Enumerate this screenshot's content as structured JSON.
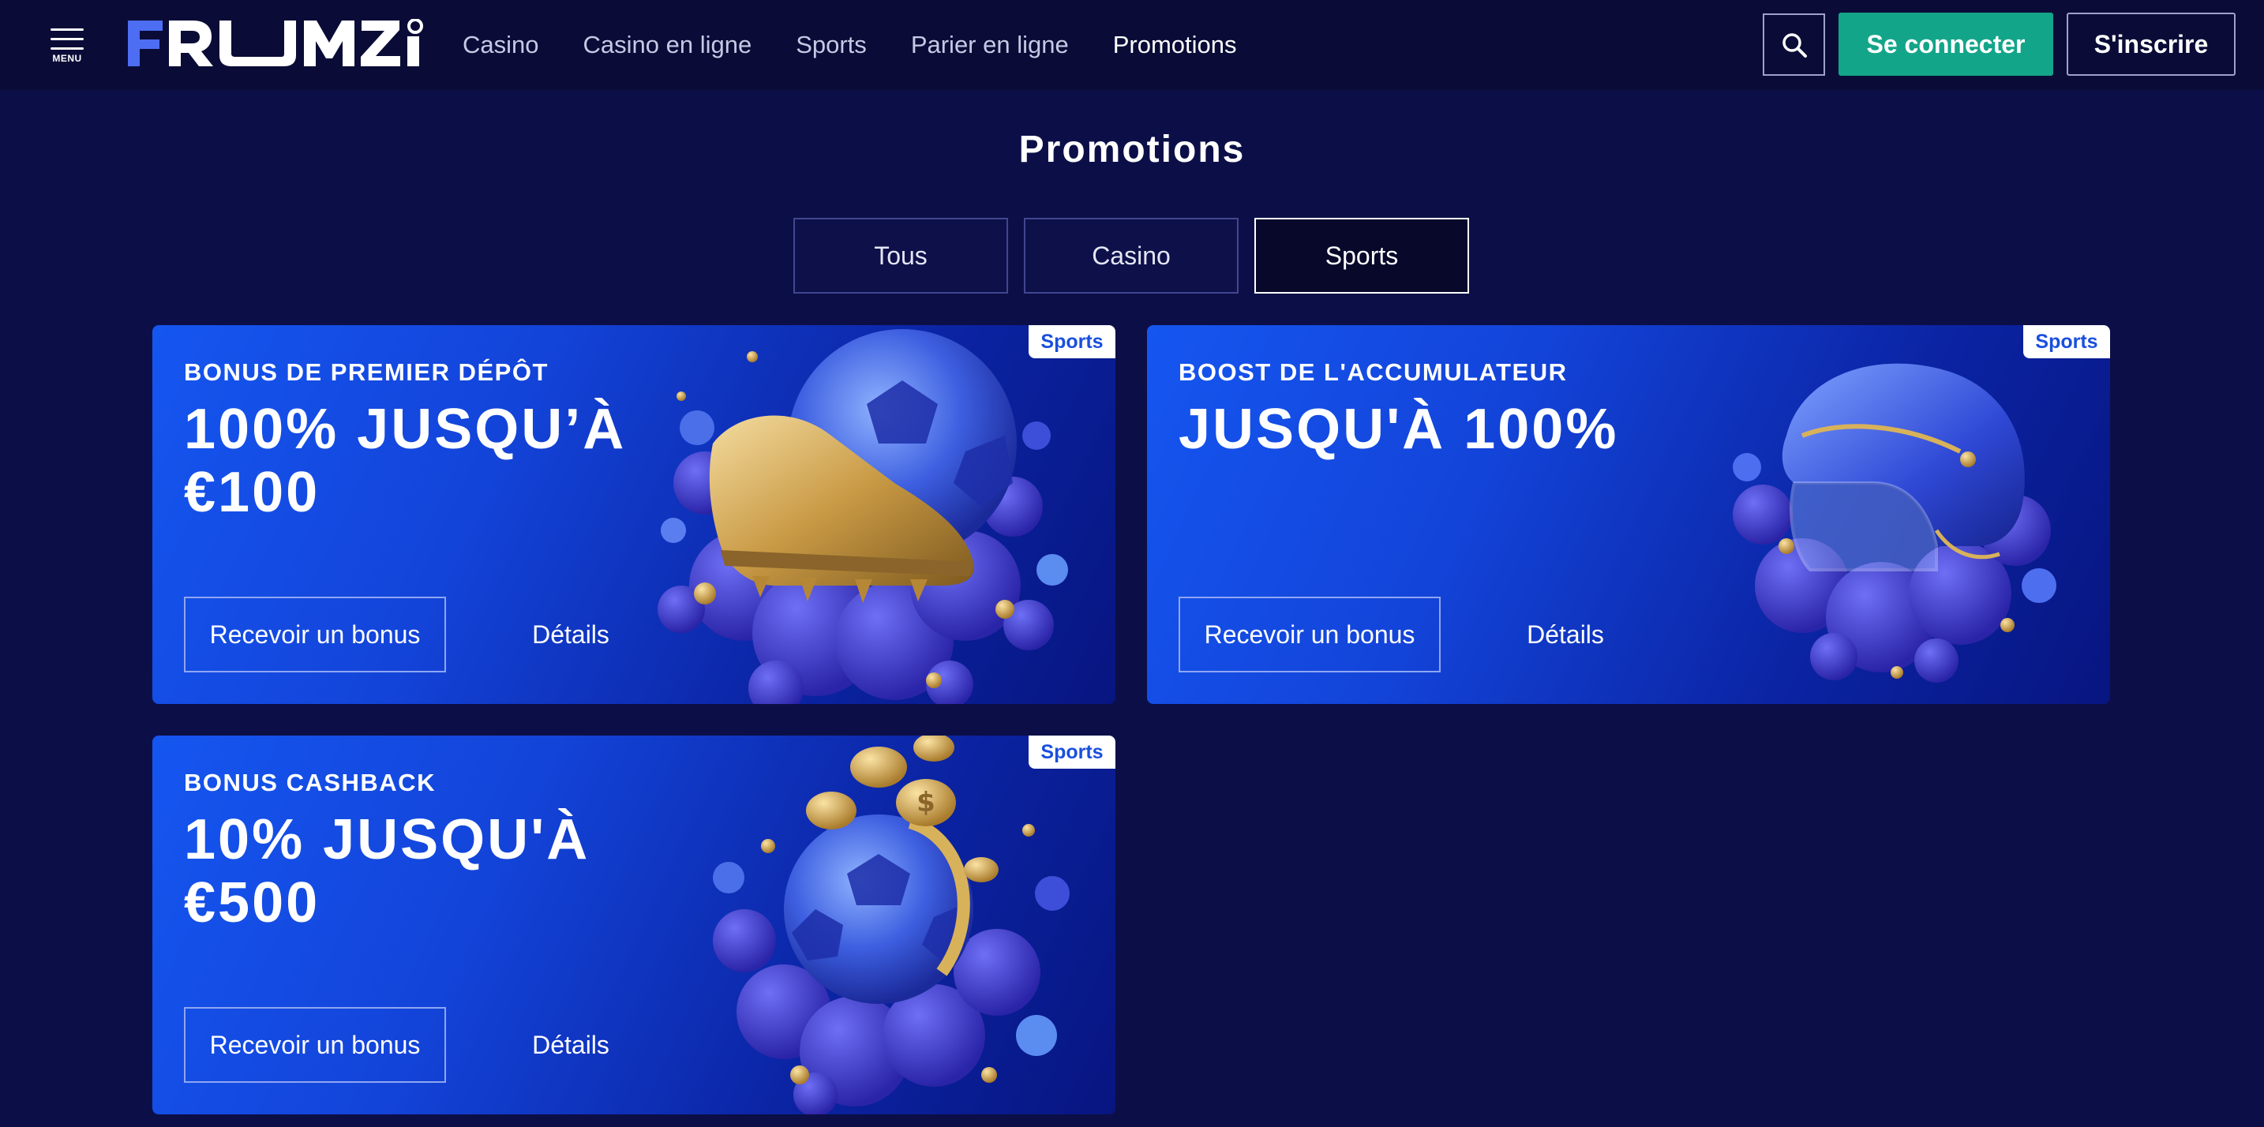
{
  "header": {
    "menu_label": "MENU",
    "logo_text": "FRUMZI",
    "nav": [
      {
        "label": "Casino"
      },
      {
        "label": "Casino en ligne"
      },
      {
        "label": "Sports"
      },
      {
        "label": "Parier en ligne"
      },
      {
        "label": "Promotions",
        "active": true
      }
    ],
    "login_label": "Se connecter",
    "register_label": "S'inscrire"
  },
  "page": {
    "title": "Promotions",
    "tabs": [
      {
        "label": "Tous"
      },
      {
        "label": "Casino"
      },
      {
        "label": "Sports",
        "active": true
      }
    ]
  },
  "promotions": [
    {
      "badge": "Sports",
      "subtitle": "BONUS DE PREMIER DÉPÔT",
      "headline": "100% JUSQU’À €100",
      "bonus_button": "Recevoir un bonus",
      "details_link": "Détails",
      "art": "golden boot and football"
    },
    {
      "badge": "Sports",
      "subtitle": "BOOST DE L'ACCUMULATEUR",
      "headline": "JUSQU'À 100%",
      "bonus_button": "Recevoir un bonus",
      "details_link": "Détails",
      "art": "hockey helmet"
    },
    {
      "badge": "Sports",
      "subtitle": "BONUS CASHBACK",
      "headline": "10% JUSQU'À €500",
      "bonus_button": "Recevoir un bonus",
      "details_link": "Détails",
      "art": "football with coins"
    }
  ],
  "colors": {
    "page_bg": "#0c0f47",
    "header_bg": "#0a0c37",
    "accent_green": "#13a58a",
    "card_blue": "#1556f0",
    "badge_text": "#1a4fde",
    "gold": "#d8b25a"
  },
  "icons": {
    "menu": "hamburger-menu-icon",
    "search": "search-icon"
  }
}
